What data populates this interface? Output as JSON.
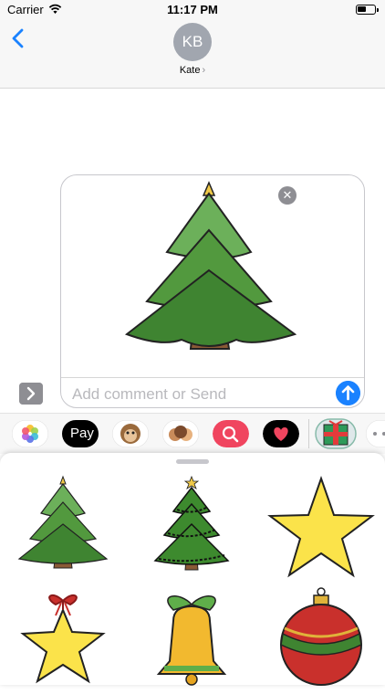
{
  "status_bar": {
    "carrier": "Carrier",
    "time": "11:17 PM"
  },
  "contact": {
    "initials": "KB",
    "name": "Kate",
    "chevron": "›"
  },
  "compose": {
    "placeholder": "Add comment or Send",
    "remove_glyph": "✕"
  },
  "apps": [
    {
      "name": "photos-app-icon"
    },
    {
      "name": "apple-pay-app-icon",
      "label": "Pay"
    },
    {
      "name": "animoji-app-icon"
    },
    {
      "name": "memoji-app-icon"
    },
    {
      "name": "image-search-app-icon"
    },
    {
      "name": "digital-touch-app-icon"
    },
    {
      "name": "christmas-sticker-app-icon"
    },
    {
      "name": "more-apps-icon"
    }
  ],
  "stickers": [
    {
      "name": "christmas-tree-sticker"
    },
    {
      "name": "decorated-tree-sticker"
    },
    {
      "name": "yellow-star-sticker"
    },
    {
      "name": "star-ornament-sticker"
    },
    {
      "name": "bell-sticker"
    },
    {
      "name": "bauble-sticker"
    }
  ],
  "colors": {
    "accent": "#1a82ff",
    "tree_green": "#4c9a3c",
    "star_yellow": "#fbe34a"
  }
}
